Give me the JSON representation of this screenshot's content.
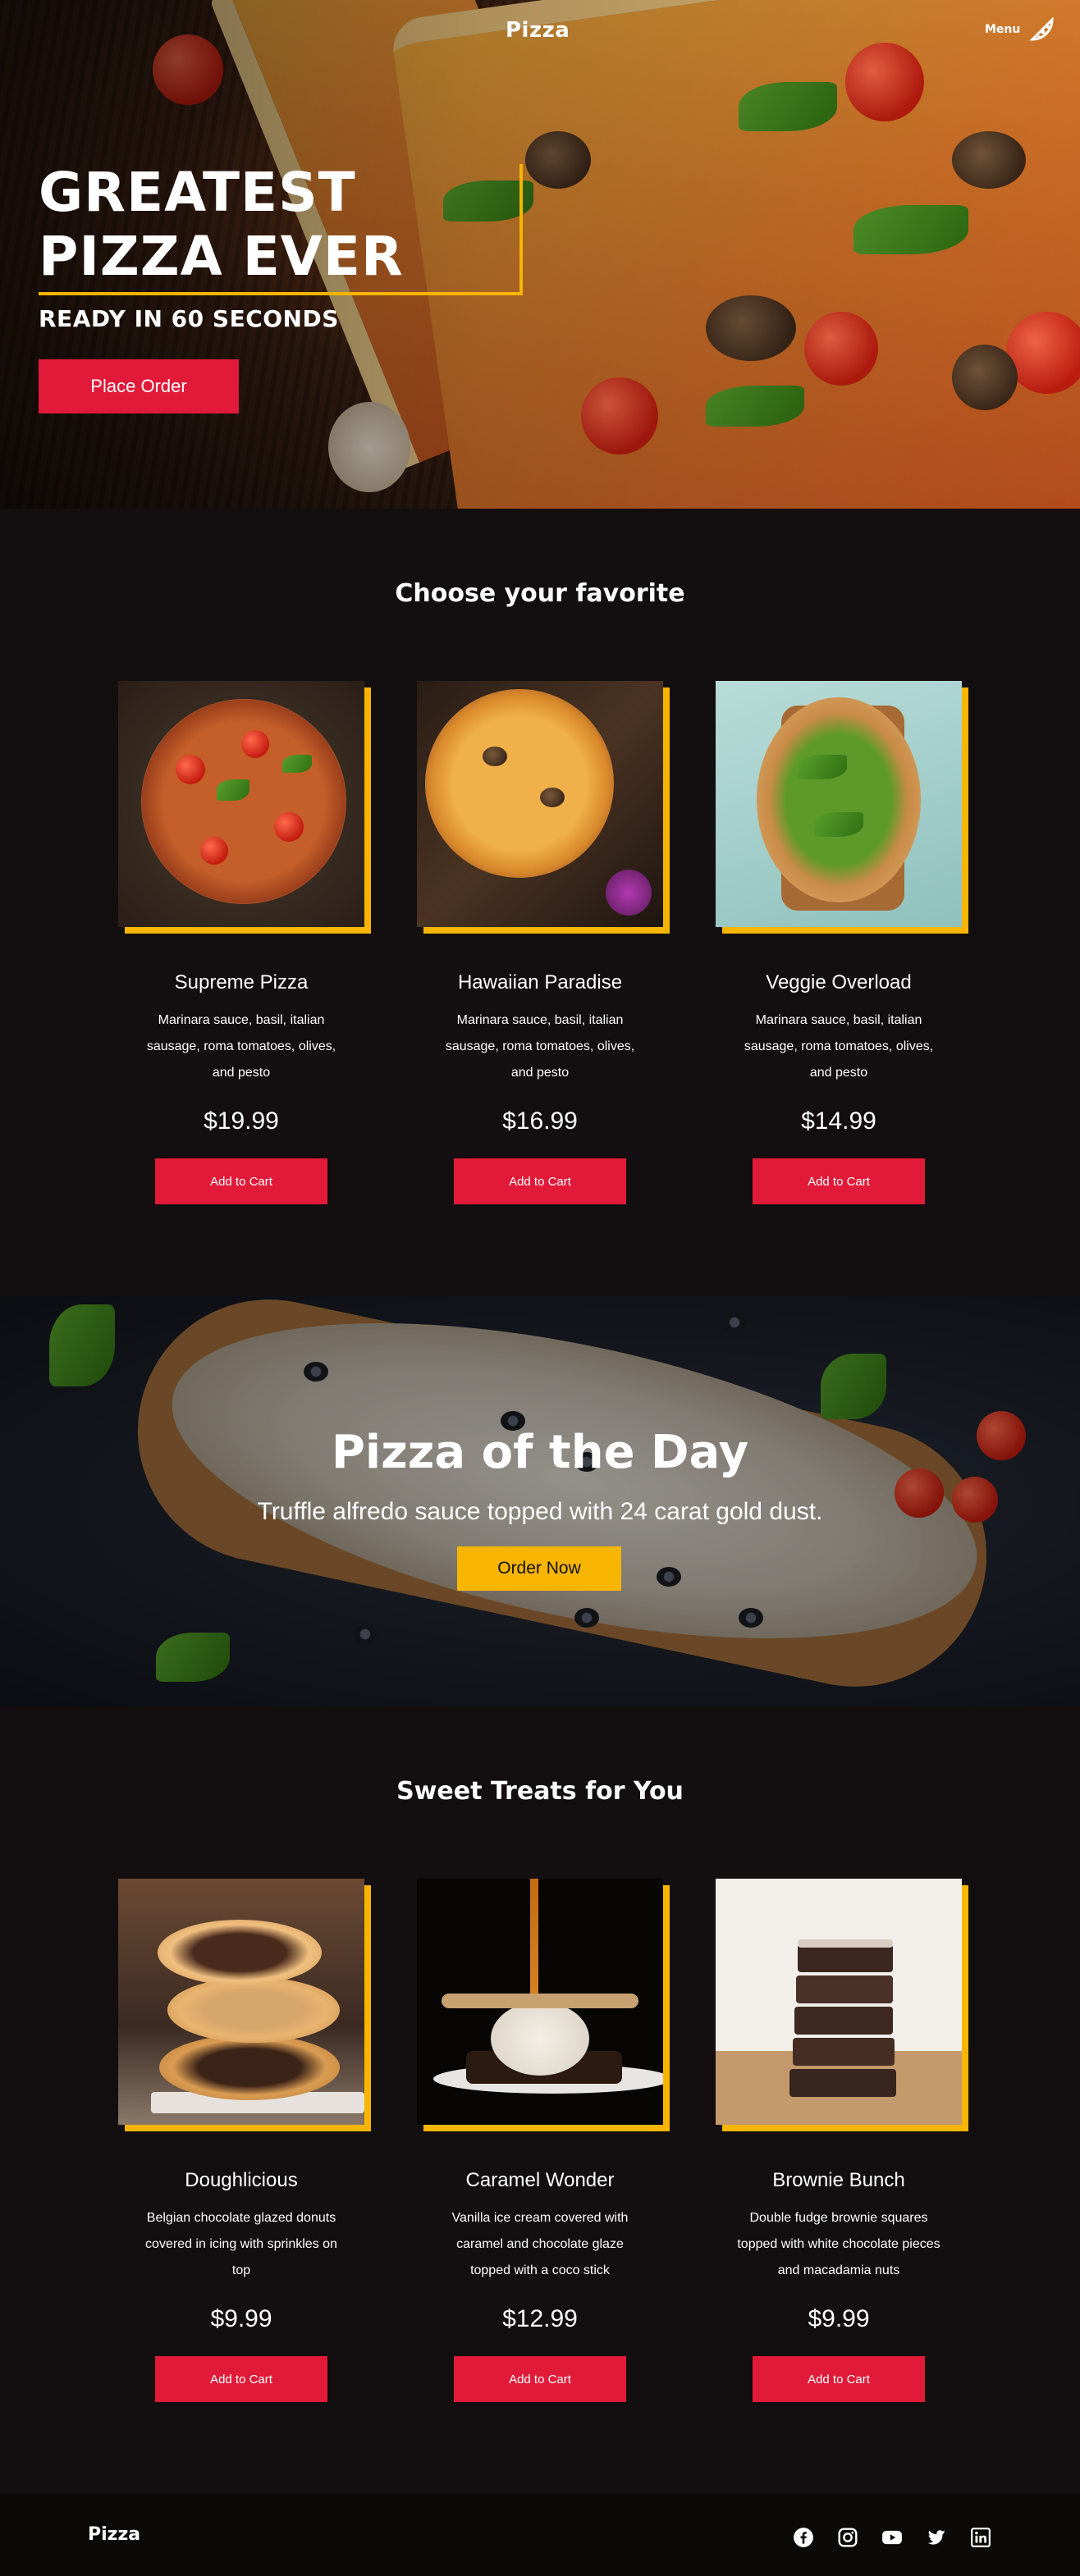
{
  "header": {
    "brand": "Pizza",
    "menu_label": "Menu"
  },
  "hero": {
    "title_line1": "GREATEST",
    "title_line2": "PIZZA EVER",
    "subtitle": "READY IN 60 SECONDS",
    "cta_label": "Place Order"
  },
  "favorites": {
    "title": "Choose your favorite",
    "items": [
      {
        "name": "Supreme Pizza",
        "description": "Marinara sauce, basil, italian sausage, roma tomatoes, olives, and pesto",
        "price": "$19.99",
        "button": "Add to Cart"
      },
      {
        "name": "Hawaiian Paradise",
        "description": "Marinara sauce, basil, italian sausage, roma tomatoes, olives, and pesto",
        "price": "$16.99",
        "button": "Add to Cart"
      },
      {
        "name": "Veggie Overload",
        "description": "Marinara sauce, basil, italian sausage, roma tomatoes, olives, and pesto",
        "price": "$14.99",
        "button": "Add to Cart"
      }
    ]
  },
  "pizza_of_the_day": {
    "title": "Pizza of the Day",
    "description": "Truffle alfredo sauce topped with 24 carat gold dust.",
    "cta_label": "Order Now"
  },
  "treats": {
    "title": "Sweet Treats for You",
    "items": [
      {
        "name": "Doughlicious",
        "description": "Belgian chocolate glazed donuts covered in icing with sprinkles on top",
        "price": "$9.99",
        "button": "Add to Cart"
      },
      {
        "name": "Caramel Wonder",
        "description": "Vanilla ice cream covered with caramel and chocolate glaze topped with a coco stick",
        "price": "$12.99",
        "button": "Add to Cart"
      },
      {
        "name": "Brownie Bunch",
        "description": "Double fudge brownie squares topped with white chocolate pieces and macadamia nuts",
        "price": "$9.99",
        "button": "Add to Cart"
      }
    ]
  },
  "footer": {
    "brand": "Pizza",
    "social_icons": [
      "facebook-icon",
      "instagram-icon",
      "youtube-icon",
      "twitter-icon",
      "linkedin-icon"
    ]
  },
  "colors": {
    "accent_red": "#e01a38",
    "accent_yellow": "#f7b500",
    "background": "#130e0f"
  }
}
